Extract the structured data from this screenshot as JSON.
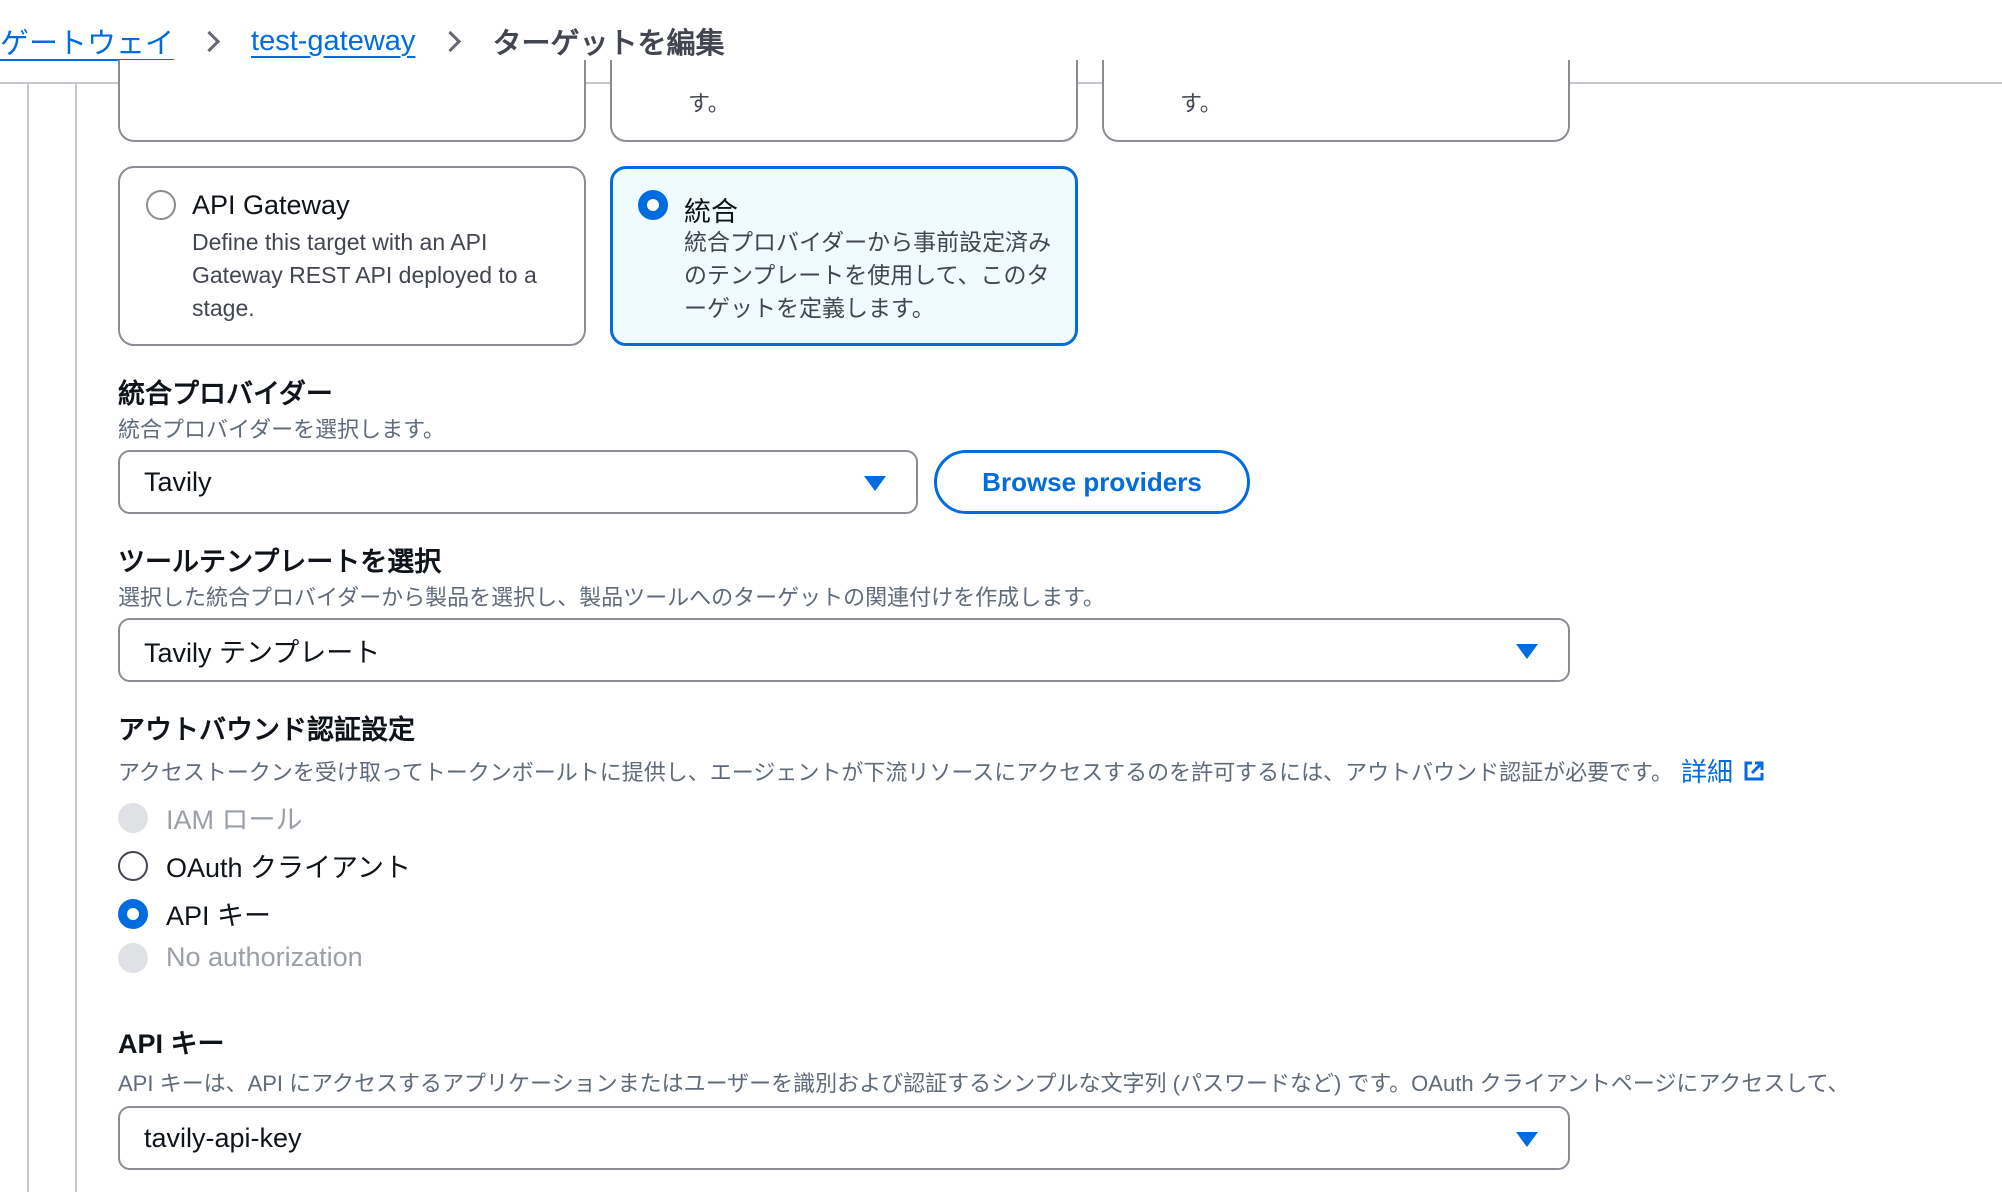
{
  "breadcrumb": {
    "items": [
      "ゲートウェイ",
      "test-gateway"
    ],
    "current": "ターゲットを編集"
  },
  "target_types": {
    "partial_tail_2": "す。",
    "partial_tail_3": "す。",
    "api_gateway": {
      "title": "API Gateway",
      "description": "Define this target with an API Gateway REST API deployed to a stage."
    },
    "integration": {
      "title": "統合",
      "description": "統合プロバイダーから事前設定済みのテンプレートを使用して、このターゲットを定義します。"
    }
  },
  "provider": {
    "label": "統合プロバイダー",
    "description": "統合プロバイダーを選択します。",
    "selected": "Tavily",
    "browse_label": "Browse providers"
  },
  "template": {
    "label": "ツールテンプレートを選択",
    "description": "選択した統合プロバイダーから製品を選択し、製品ツールへのターゲットの関連付けを作成します。",
    "selected": "Tavily テンプレート"
  },
  "outbound_auth": {
    "label": "アウトバウンド認証設定",
    "description": "アクセストークンを受け取ってトークンボールトに提供し、エージェントが下流リソースにアクセスするのを許可するには、アウトバウンド認証が必要です。",
    "info_link": "詳細",
    "options": [
      {
        "label": "IAM ロール",
        "state": "disabled"
      },
      {
        "label": "OAuth クライアント",
        "state": "off"
      },
      {
        "label": "API キー",
        "state": "on"
      },
      {
        "label": "No authorization",
        "state": "disabled"
      }
    ]
  },
  "api_key": {
    "label": "API キー",
    "description": "API キーは、API にアクセスするアプリケーションまたはユーザーを識別および認証するシンプルな文字列 (パスワードなど) です。OAuth クライアントページにアクセスして、",
    "selected": "tavily-api-key"
  },
  "colors": {
    "accent": "#006ce0",
    "selected_tile_bg": "#f0fbff",
    "border": "#8c8c94"
  }
}
